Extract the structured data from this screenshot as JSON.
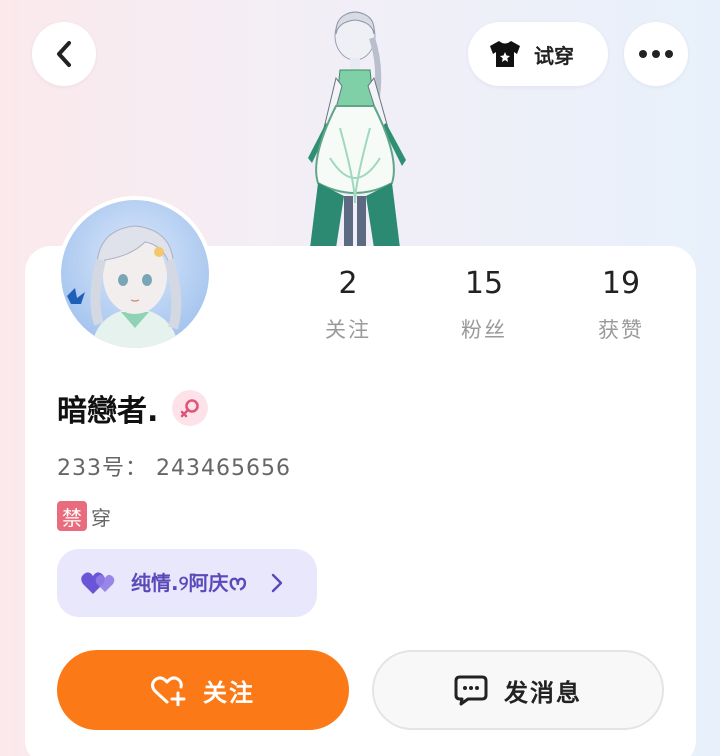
{
  "header": {
    "back_icon": "chevron-left-icon",
    "tryon_label": "试穿",
    "tryon_icon": "tshirt-icon",
    "more_icon": "more-dots-icon"
  },
  "profile": {
    "username": "暗戀者.",
    "gender": "female-icon",
    "id_text": "233号： 243465656",
    "ban_tag": "禁",
    "ban_text": "穿"
  },
  "stats": [
    {
      "value": "2",
      "label": "关注"
    },
    {
      "value": "15",
      "label": "粉丝"
    },
    {
      "value": "19",
      "label": "获赞"
    }
  ],
  "partner": {
    "name": "纯情.୨阿庆ᰔ",
    "icon": "double-heart-icon"
  },
  "actions": {
    "follow_label": "关注",
    "follow_icon": "heart-plus-icon",
    "message_label": "发消息",
    "message_icon": "chat-bubble-icon"
  },
  "colors": {
    "accent": "#fb7a17",
    "partner_bg": "#e9e7fb",
    "partner_text": "#5b49b9",
    "ban_tag": "#e86c7e"
  }
}
